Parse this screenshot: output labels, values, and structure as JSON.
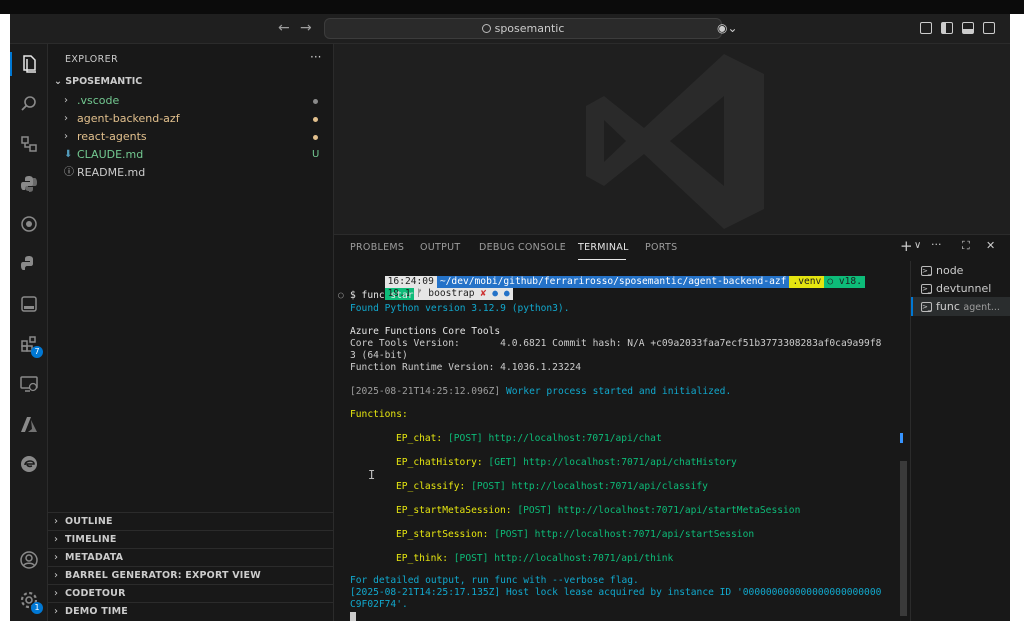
{
  "titlebar": {
    "search_text": "sposemantic",
    "back_icon": "arrow-left-icon",
    "forward_icon": "arrow-right-icon"
  },
  "activity": {
    "extensions_badge": "7",
    "settings_badge": "1"
  },
  "explorer": {
    "title": "EXPLORER",
    "more": "···",
    "root": "SPOSEMANTIC",
    "items": [
      {
        "label": ".vscode",
        "chev": "›",
        "color": "#73c991",
        "status": "dot",
        "status_color": "#8a8a8a"
      },
      {
        "label": "agent-backend-azf",
        "chev": "›",
        "color": "#e2c08d",
        "status": "dot",
        "status_color": "#e2c08d"
      },
      {
        "label": "react-agents",
        "chev": "›",
        "color": "#e2c08d",
        "status": "dot",
        "status_color": "#e2c08d"
      },
      {
        "label": "CLAUDE.md",
        "chev": "⬇",
        "color": "#73c991",
        "status": "U",
        "status_color": "#73c991"
      },
      {
        "label": "README.md",
        "chev": "ⓘ",
        "color": "#cccccc",
        "status": "",
        "status_color": ""
      }
    ]
  },
  "sections": [
    "OUTLINE",
    "TIMELINE",
    "METADATA",
    "BARREL GENERATOR: EXPORT VIEW",
    "CODETOUR",
    "DEMO TIME"
  ],
  "panel": {
    "tabs": [
      "PROBLEMS",
      "OUTPUT",
      "DEBUG CONSOLE",
      "TERMINAL",
      "PORTS"
    ],
    "active_tab": "TERMINAL",
    "actions": {
      "add": "+",
      "split_chev": "∨",
      "more": "···",
      "maximize": "⛶",
      "close": "✕"
    }
  },
  "terminal": {
    "prompt_time": "16:24:09",
    "prompt_path": "~/dev/mobi/github/ferrarirosso/sposemantic/agent-backend-azf",
    "prompt_venv": ".venv",
    "prompt_node": "○ v18.",
    "prompt_node2": "19.1",
    "prompt_branch": "ᚠ boostrap",
    "prompt_dirty": "✘",
    "prompt_marks": "● ●",
    "command_prefix": "○",
    "command": "$ func start",
    "python_found": "Found Python version 3.12.9 (python3).",
    "core_tools_title": "Azure Functions Core Tools",
    "core_tools_version": "Core Tools Version:       4.0.6821 Commit hash: N/A +c09a2033faa7ecf51b3773308283af0ca9a99f8",
    "core_tools_version2": "3 (64-bit)",
    "runtime_version": "Function Runtime Version: 4.1036.1.23224",
    "worker_ts": "[2025-08-21T14:25:12.096Z]",
    "worker_msg": "Worker process started and initialized.",
    "functions_label": "Functions:",
    "functions": [
      {
        "name": "EP_chat:",
        "method": "[POST]",
        "url": "http://localhost:7071/api/chat"
      },
      {
        "name": "EP_chatHistory:",
        "method": "[GET]",
        "url": "http://localhost:7071/api/chatHistory"
      },
      {
        "name": "EP_classify:",
        "method": "[POST]",
        "url": "http://localhost:7071/api/classify"
      },
      {
        "name": "EP_startMetaSession:",
        "method": "[POST]",
        "url": "http://localhost:7071/api/startMetaSession"
      },
      {
        "name": "EP_startSession:",
        "method": "[POST]",
        "url": "http://localhost:7071/api/startSession"
      },
      {
        "name": "EP_think:",
        "method": "[POST]",
        "url": "http://localhost:7071/api/think"
      }
    ],
    "verbose_hint": "For detailed output, run func with --verbose flag.",
    "lock_line1": "[2025-08-21T14:25:17.135Z] Host lock lease acquired by instance ID '000000000000000000000000",
    "lock_line2": "C9F02F74'."
  },
  "terminal_list": [
    {
      "label": "node",
      "sub": ""
    },
    {
      "label": "devtunnel",
      "sub": ""
    },
    {
      "label": "func",
      "sub": "agent..."
    }
  ],
  "colors": {
    "accent": "#0078d4",
    "func_name": "#e5e510",
    "func_method": "#0dbc79",
    "url": "#0dbc79",
    "info": "#11a8cd"
  }
}
